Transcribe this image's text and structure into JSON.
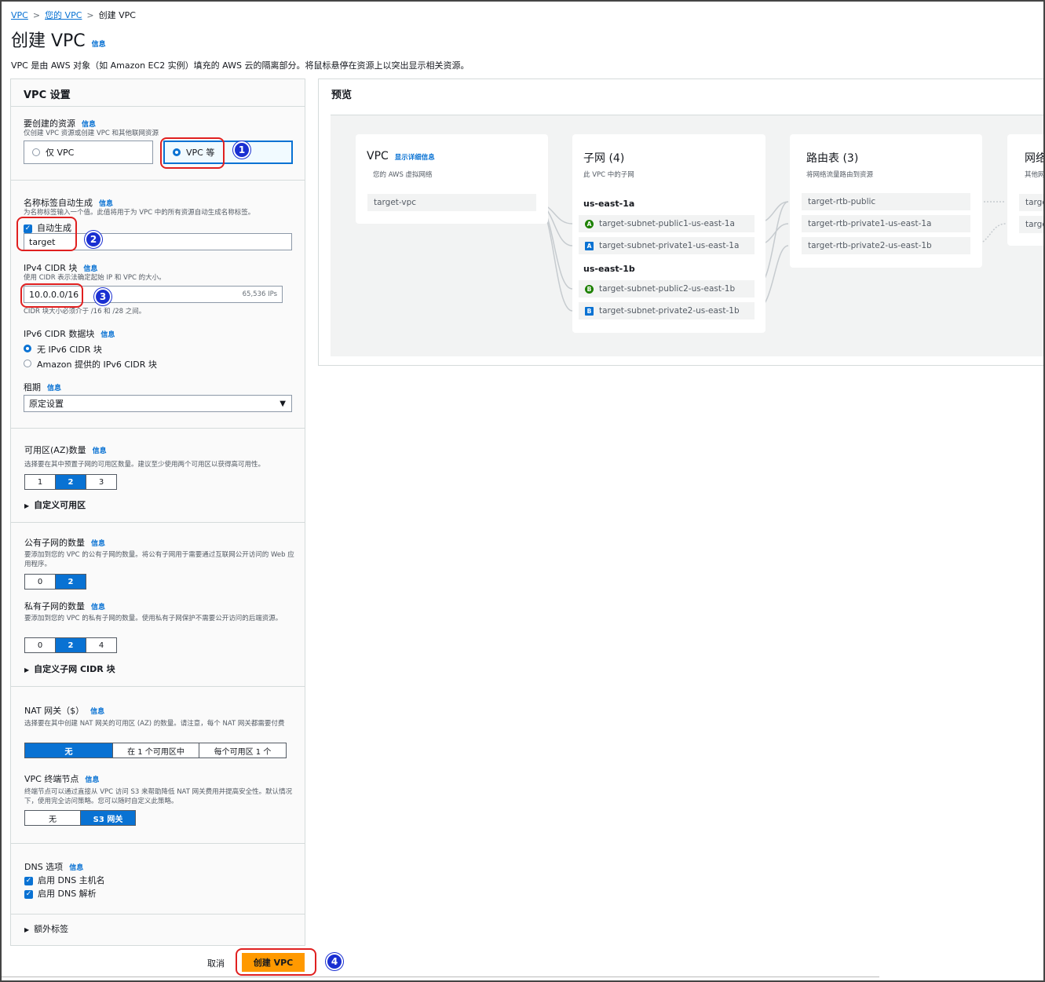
{
  "breadcrumb": {
    "items": [
      "VPC",
      "您的 VPC",
      "创建 VPC"
    ]
  },
  "header": {
    "title": "创建 VPC",
    "info": "信息",
    "description": "VPC 是由 AWS 对象（如 Amazon EC2 实例）填充的 AWS 云的隔离部分。将鼠标悬停在资源上以突出显示相关资源。"
  },
  "settings": {
    "title": "VPC 设置",
    "resources": {
      "label": "要创建的资源",
      "info": "信息",
      "sub": "仅创建 VPC 资源或创建 VPC 和其他联网资源",
      "options": [
        "仅 VPC",
        "VPC 等"
      ],
      "selected": "VPC 等"
    },
    "name_tag": {
      "label": "名称标签自动生成",
      "info": "信息",
      "sub": "为名称标签输入一个值。此值将用于为 VPC 中的所有资源自动生成名称标签。",
      "checkbox_label": "自动生成",
      "value": "target"
    },
    "ipv4": {
      "label": "IPv4 CIDR 块",
      "info": "信息",
      "sub": "使用 CIDR 表示法确定起始 IP 和 VPC 的大小。",
      "value": "10.0.0.0/16",
      "ips": "65,536 IPs",
      "hint": "CIDR 块大小必须介于 /16 和 /28 之间。"
    },
    "ipv6": {
      "label": "IPv6 CIDR 数据块",
      "info": "信息",
      "options": [
        "无 IPv6 CIDR 块",
        "Amazon 提供的 IPv6 CIDR 块"
      ],
      "selected": "无 IPv6 CIDR 块"
    },
    "tenancy": {
      "label": "租期",
      "info": "信息",
      "value": "原定设置"
    },
    "az": {
      "label": "可用区(AZ)数量",
      "info": "信息",
      "sub": "选择要在其中预置子网的可用区数量。建议至少使用两个可用区以获得高可用性。",
      "options": [
        "1",
        "2",
        "3"
      ],
      "selected": "2",
      "expander": "自定义可用区"
    },
    "public_subnets": {
      "label": "公有子网的数量",
      "info": "信息",
      "sub": "要添加到您的 VPC 的公有子网的数量。将公有子网用于需要通过互联网公开访问的 Web 应用程序。",
      "options": [
        "0",
        "2"
      ],
      "selected": "2"
    },
    "private_subnets": {
      "label": "私有子网的数量",
      "info": "信息",
      "sub": "要添加到您的 VPC 的私有子网的数量。使用私有子网保护不需要公开访问的后端资源。",
      "options": [
        "0",
        "2",
        "4"
      ],
      "selected": "2",
      "expander": "自定义子网 CIDR 块"
    },
    "nat": {
      "label": "NAT 网关（$）",
      "info": "信息",
      "sub": "选择要在其中创建 NAT 网关的可用区 (AZ) 的数量。请注意，每个 NAT 网关都需要付费",
      "options": [
        "无",
        "在 1 个可用区中",
        "每个可用区 1 个"
      ],
      "selected": "无"
    },
    "endpoint": {
      "label": "VPC 终端节点",
      "info": "信息",
      "sub": "终端节点可以通过直接从 VPC 访问 S3 来帮助降低 NAT 网关费用并提高安全性。默认情况下，使用完全访问策略。您可以随时自定义此策略。",
      "options": [
        "无",
        "S3 网关"
      ],
      "selected": "S3 网关"
    },
    "dns": {
      "label": "DNS 选项",
      "info": "信息",
      "options": [
        "启用 DNS 主机名",
        "启用 DNS 解析"
      ]
    },
    "tags_expander": "额外标签"
  },
  "preview": {
    "title": "预览",
    "vpc_card": {
      "title": "VPC",
      "detail_link": "显示详细信息",
      "sub": "您的 AWS 虚拟网络",
      "items": [
        "target-vpc"
      ]
    },
    "subnet_card": {
      "title": "子网 (4)",
      "sub": "此 VPC 中的子网",
      "zones": [
        {
          "name": "us-east-1a",
          "subnets": [
            {
              "badge": "A",
              "type": "public",
              "name": "target-subnet-public1-us-east-1a"
            },
            {
              "badge": "A",
              "type": "private",
              "name": "target-subnet-private1-us-east-1a"
            }
          ]
        },
        {
          "name": "us-east-1b",
          "subnets": [
            {
              "badge": "B",
              "type": "public",
              "name": "target-subnet-public2-us-east-1b"
            },
            {
              "badge": "B",
              "type": "private",
              "name": "target-subnet-private2-us-east-1b"
            }
          ]
        }
      ]
    },
    "route_card": {
      "title": "路由表 (3)",
      "sub": "将网络流量路由到资源",
      "items": [
        "target-rtb-public",
        "target-rtb-private1-us-east-1a",
        "target-rtb-private2-us-east-1b"
      ]
    },
    "network_card": {
      "title": "网络",
      "sub": "其他网",
      "items": [
        "targe",
        "targe"
      ]
    }
  },
  "footer": {
    "cancel": "取消",
    "create": "创建 VPC"
  },
  "annotations": [
    "1",
    "2",
    "3",
    "4"
  ],
  "colors": {
    "accent": "#0972d3",
    "primary_button": "#ff9900",
    "callout": "#e02020",
    "badge": "#1a2fd1",
    "public_subnet": "#1d8102"
  }
}
